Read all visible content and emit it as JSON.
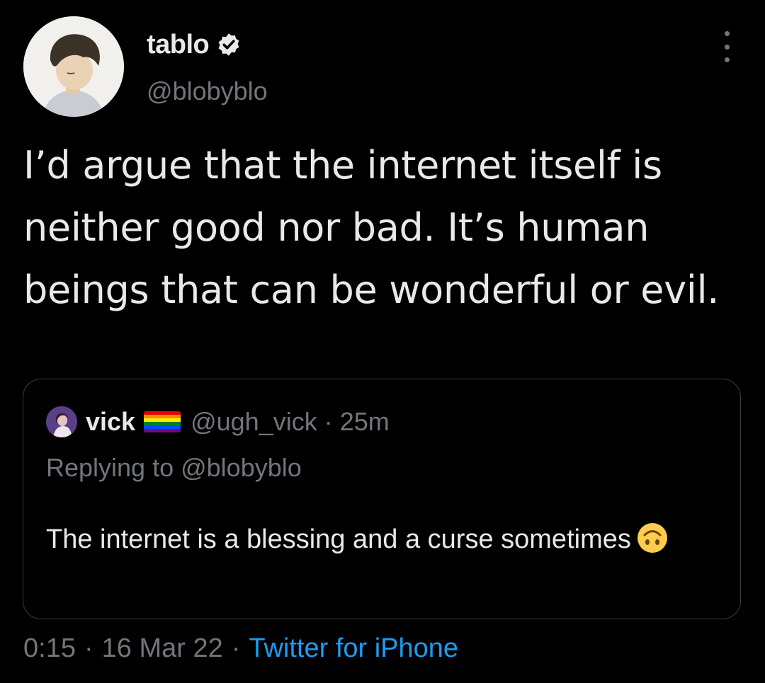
{
  "author": {
    "display_name": "tablo",
    "handle": "@blobyblo",
    "verified_icon": "verified-badge-icon"
  },
  "tweet": {
    "text": "I’d argue that the internet itself is neither good nor bad. It’s human beings that can be wonderful or evil.",
    "time": "0:15",
    "separator": "·",
    "date": "16 Mar 22",
    "source": "Twitter for iPhone"
  },
  "quoted": {
    "display_name": "vick",
    "flag_icon": "rainbow-flag-icon",
    "handle": "@ugh_vick",
    "separator": "·",
    "time": "25m",
    "replying_to": "Replying to @blobyblo",
    "text": "The internet is a blessing and a curse sometimes",
    "emoji_icon": "upside-down-face-emoji-icon"
  },
  "colors": {
    "background": "#000000",
    "text_primary": "#e7e9ea",
    "text_secondary": "#71767b",
    "link": "#1d9bf0",
    "border": "#3a3d41"
  }
}
